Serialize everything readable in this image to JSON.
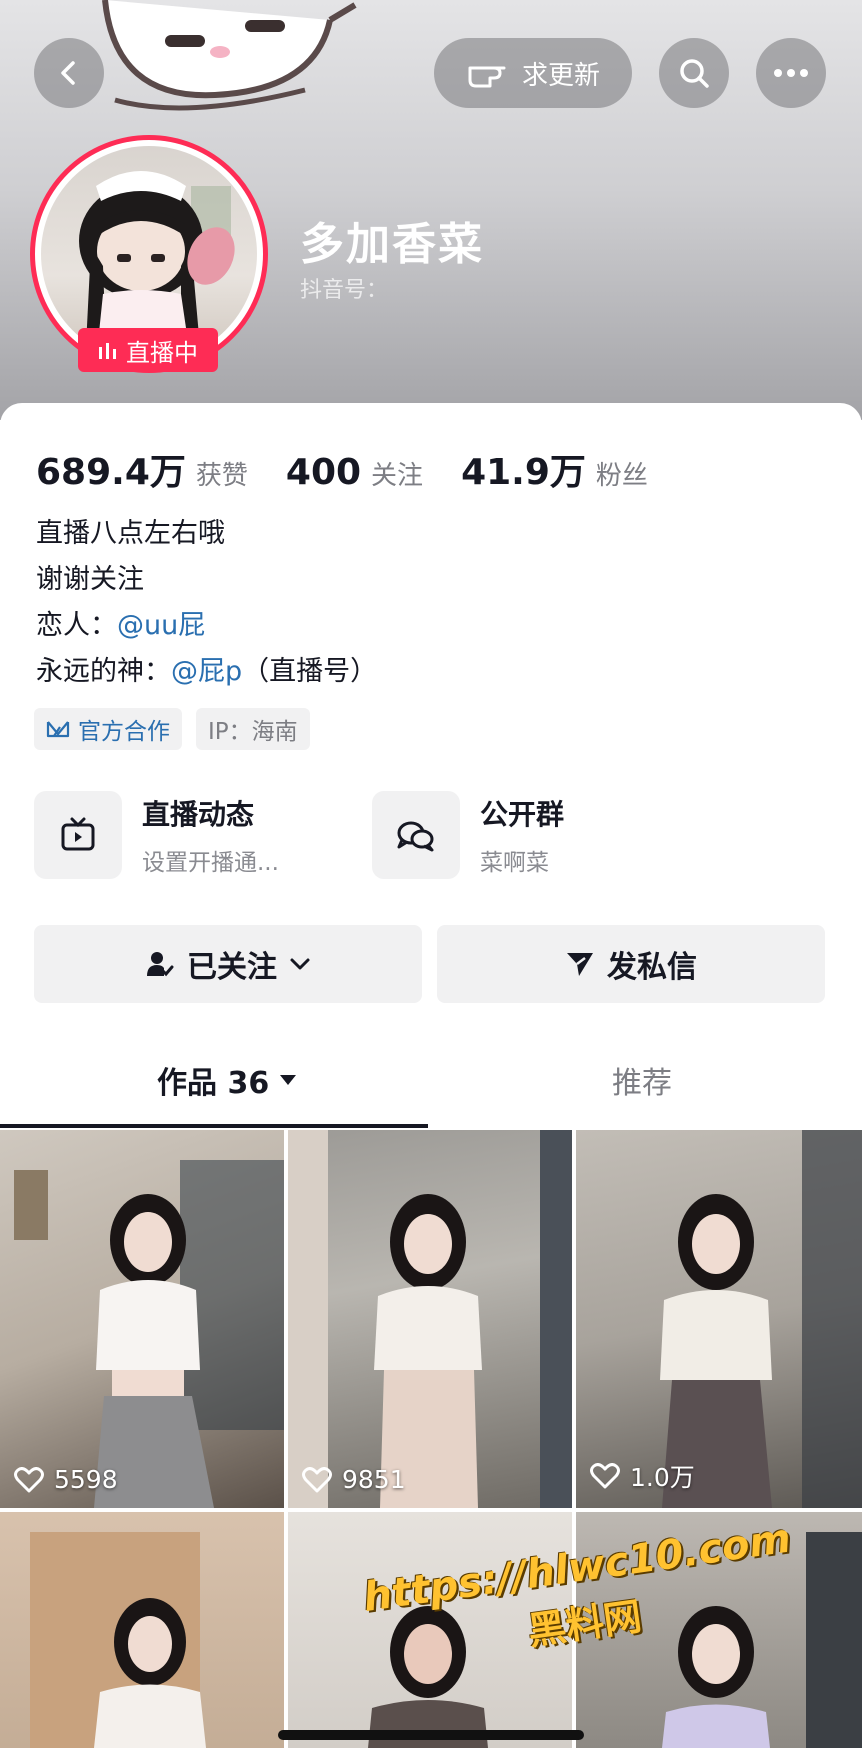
{
  "header": {
    "back_icon": "chevron-left-icon",
    "request_update_label": "求更新",
    "request_update_icon": "pointing-hand-icon",
    "search_icon": "search-icon",
    "more_icon": "more-horizontal-icon",
    "username": "多加香菜",
    "douyin_id": "抖音号：",
    "live_badge": "直播中"
  },
  "stats": [
    {
      "value": "689.4万",
      "label": "获赞"
    },
    {
      "value": "400",
      "label": "关注"
    },
    {
      "value": "41.9万",
      "label": "粉丝"
    }
  ],
  "bio": {
    "line1": "直播八点左右哦",
    "line2": "谢谢关注",
    "line3_prefix": "恋人：",
    "line3_mention": "@uu屁",
    "line4_prefix": "永远的神：",
    "line4_mention": "@屁p",
    "line4_suffix": "（直播号）"
  },
  "tags": {
    "official": "官方合作",
    "ip": "IP：海南"
  },
  "features": [
    {
      "title": "直播动态",
      "subtitle": "设置开播通...",
      "icon": "tv-icon"
    },
    {
      "title": "公开群",
      "subtitle": "菜啊菜",
      "icon": "chat-group-icon"
    }
  ],
  "actions": {
    "follow_label": "已关注",
    "message_label": "发私信"
  },
  "tabs": {
    "works_label": "作品 36",
    "recommend_label": "推荐"
  },
  "videos": [
    {
      "likes": "5598"
    },
    {
      "likes": "9851"
    },
    {
      "likes": "1.0万"
    },
    {
      "likes": ""
    },
    {
      "likes": ""
    },
    {
      "likes": ""
    }
  ],
  "watermark": {
    "url": "https://hlwc10.com",
    "name": "黑料网"
  },
  "colors": {
    "accent": "#fe2c55",
    "link": "#2a6fb0",
    "watermark": "#ffc230"
  }
}
